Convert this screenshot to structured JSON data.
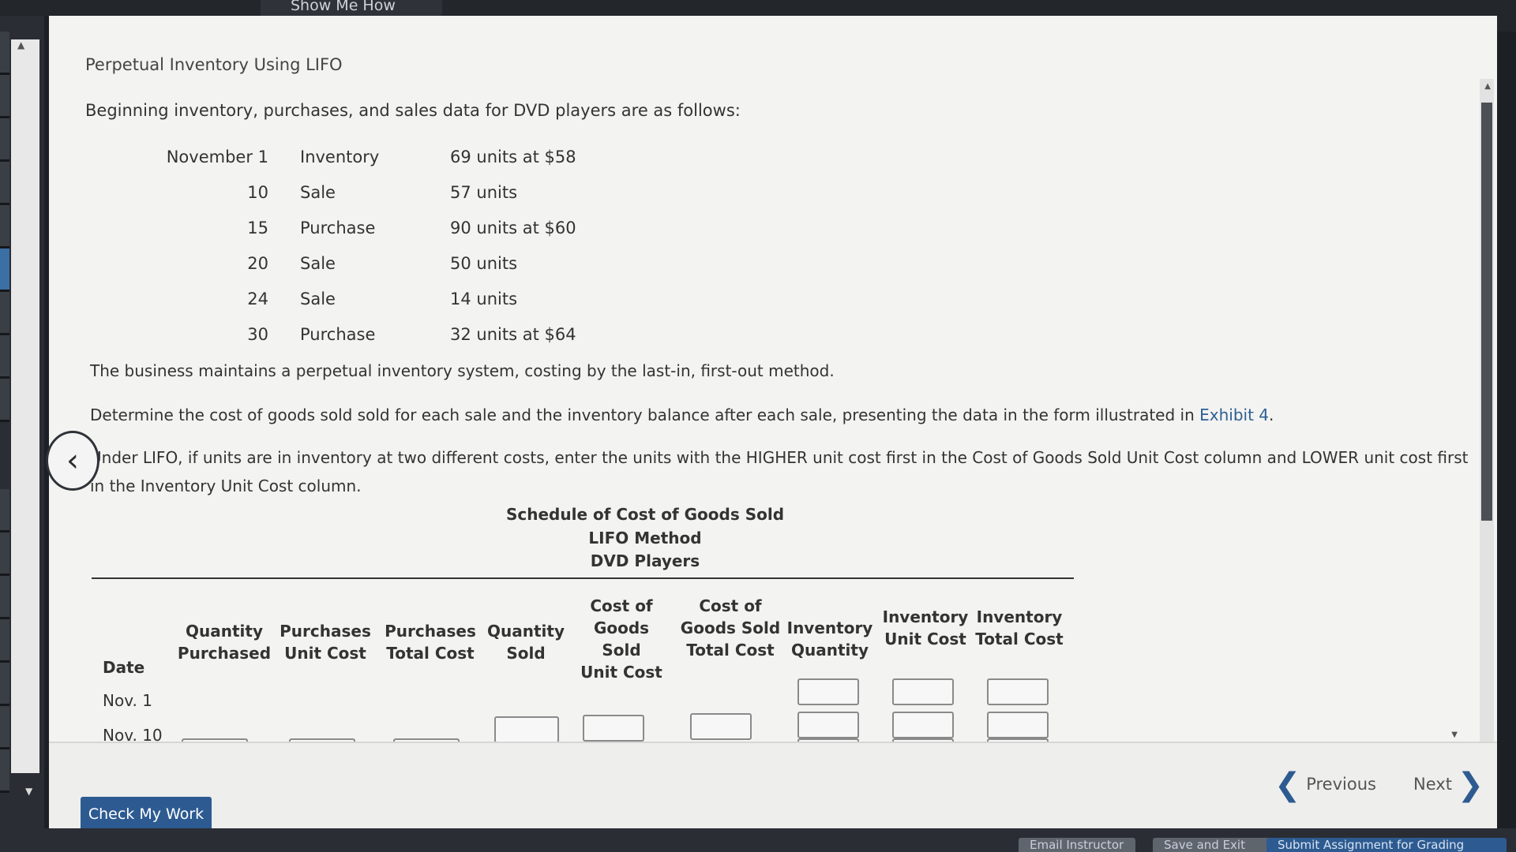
{
  "topbar": {
    "show_me_how": "Show Me How"
  },
  "problem": {
    "title": "Perpetual Inventory Using LIFO",
    "intro": "Beginning inventory, purchases, and sales data for DVD players are as follows:",
    "data_rows": [
      {
        "date": "November 1",
        "type": "Inventory",
        "desc": "69 units at $58"
      },
      {
        "date": "10",
        "type": "Sale",
        "desc": "57 units"
      },
      {
        "date": "15",
        "type": "Purchase",
        "desc": "90 units at $60"
      },
      {
        "date": "20",
        "type": "Sale",
        "desc": "50 units"
      },
      {
        "date": "24",
        "type": "Sale",
        "desc": "14 units"
      },
      {
        "date": "30",
        "type": "Purchase",
        "desc": "32 units at $64"
      }
    ],
    "para1": "The business maintains a perpetual inventory system, costing by the last-in, first-out method.",
    "para2_text": "Determine the cost of goods sold sold for each sale and the inventory balance after each sale, presenting the data in the form illustrated in ",
    "para2_link": "Exhibit 4",
    "para2_end": ".",
    "para3": "Under LIFO, if units are in inventory at two different costs, enter the units with the HIGHER unit cost first in the Cost of Goods Sold Unit Cost column and LOWER unit cost first in the Inventory Unit Cost column."
  },
  "schedule": {
    "title1": "Schedule of Cost of Goods Sold",
    "title2": "LIFO Method",
    "title3": "DVD Players",
    "headers": {
      "date": "Date",
      "qty_purchased_1": "Quantity",
      "qty_purchased_2": "Purchased",
      "pur_unit_1": "Purchases",
      "pur_unit_2": "Unit Cost",
      "pur_total_1": "Purchases",
      "pur_total_2": "Total Cost",
      "qty_sold_1": "Quantity",
      "qty_sold_2": "Sold",
      "cogs_unit_1": "Cost of",
      "cogs_unit_2": "Goods Sold",
      "cogs_unit_3": "Unit Cost",
      "cogs_total_1": "Cost of",
      "cogs_total_2": "Goods Sold",
      "cogs_total_3": "Total Cost",
      "inv_qty_1": "Inventory",
      "inv_qty_2": "Quantity",
      "inv_unit_1": "Inventory",
      "inv_unit_2": "Unit Cost",
      "inv_total_1": "Inventory",
      "inv_total_2": "Total Cost"
    },
    "rows": [
      {
        "date": "Nov. 1"
      },
      {
        "date": "Nov. 10"
      }
    ]
  },
  "footer": {
    "check_my_work": "Check My Work",
    "previous": "Previous",
    "next": "Next"
  },
  "bottombar": {
    "email": "Email Instructor",
    "save_exit": "Save and Exit",
    "submit": "Submit Assignment for Grading"
  }
}
